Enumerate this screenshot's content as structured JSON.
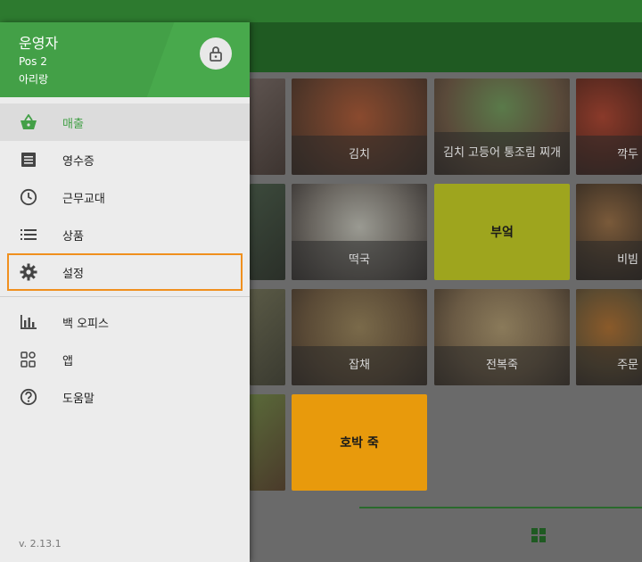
{
  "drawer": {
    "user": "운영자",
    "pos": "Pos 2",
    "store": "아리랑",
    "menu": [
      {
        "label": "매출",
        "icon": "basket-icon"
      },
      {
        "label": "영수증",
        "icon": "receipt-icon"
      },
      {
        "label": "근무교대",
        "icon": "clock-icon"
      },
      {
        "label": "상품",
        "icon": "list-icon"
      },
      {
        "label": "설정",
        "icon": "gear-icon"
      }
    ],
    "menu2": [
      {
        "label": "백 오피스",
        "icon": "bar-chart-icon"
      },
      {
        "label": "앱",
        "icon": "apps-icon"
      },
      {
        "label": "도움말",
        "icon": "help-icon"
      }
    ],
    "version": "v. 2.13.1"
  },
  "items": [
    {
      "label": "김치"
    },
    {
      "label": "김치 고등어 통조림 찌개"
    },
    {
      "label": "깍두"
    },
    {
      "label": "떡국"
    },
    {
      "label": "부엌"
    },
    {
      "label": "비빔"
    },
    {
      "label": "잡채"
    },
    {
      "label": "전복죽"
    },
    {
      "label": "주문"
    },
    {
      "label": "호박 죽"
    }
  ],
  "colors": {
    "accent": "#43a047",
    "focus": "#f0901e",
    "tile_yellow_green": "#9ea51e",
    "tile_orange": "#e89a0c"
  }
}
